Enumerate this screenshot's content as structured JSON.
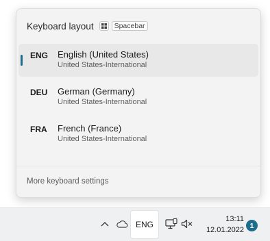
{
  "flyout": {
    "title": "Keyboard layout",
    "shortcut_key_icon": "windows-key-icon",
    "shortcut_key": "Spacebar",
    "languages": [
      {
        "code": "ENG",
        "name": "English (United States)",
        "layout": "United States-International",
        "selected": true
      },
      {
        "code": "DEU",
        "name": "German (Germany)",
        "layout": "United States-International",
        "selected": false
      },
      {
        "code": "FRA",
        "name": "French (France)",
        "layout": "United States-International",
        "selected": false
      }
    ],
    "more_settings": "More keyboard settings"
  },
  "taskbar": {
    "input_indicator": "ENG",
    "time": "13:11",
    "date": "12.01.2022",
    "notification_count": "1",
    "icons": [
      "chevron-up-icon",
      "onedrive-cloud-icon",
      "network-monitor-icon",
      "speaker-muted-icon"
    ]
  },
  "colors": {
    "accent": "#1d6c8b",
    "flyout_bg": "#f3f3f3",
    "selected_row_bg": "#e8e8e8",
    "taskbar_bg": "#eef0f2"
  }
}
